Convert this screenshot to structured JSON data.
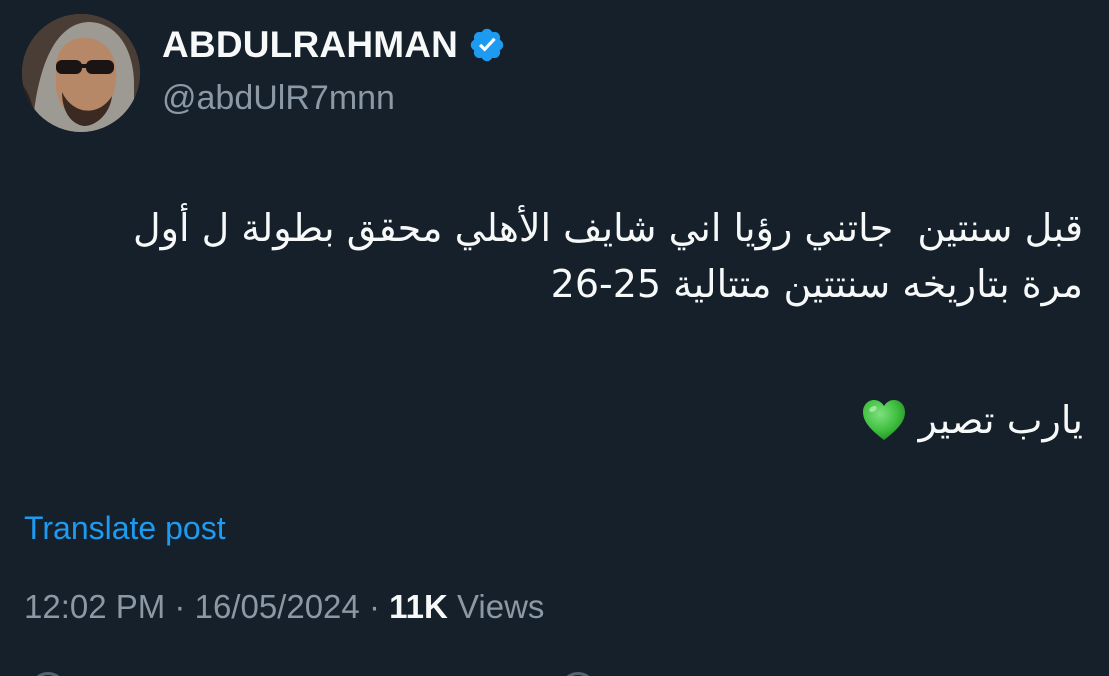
{
  "author": {
    "display_name": "ABDULRAHMAN",
    "handle": "@abdUlR7mnn",
    "verified": true,
    "avatar_icon": "profile-photo"
  },
  "tweet": {
    "line_1": "قبل سنتين  جاتني رؤيا اني شايف الأهلي محقق بطولة ل أول",
    "line_2": "مرة بتاريخه سنتتين متتالية 25-26",
    "line_3": "يارب تصير",
    "emoji": "green-heart"
  },
  "translate_label": "Translate post",
  "meta": {
    "time": "12:02 PM",
    "date": "16/05/2024",
    "views_count": "11K",
    "views_label": "Views",
    "separator": "·"
  },
  "colors": {
    "background": "#15202b",
    "text": "#f7f9f9",
    "secondary": "#8b98a5",
    "accent": "#1d9bf0",
    "heart": "#3fbf3f"
  }
}
